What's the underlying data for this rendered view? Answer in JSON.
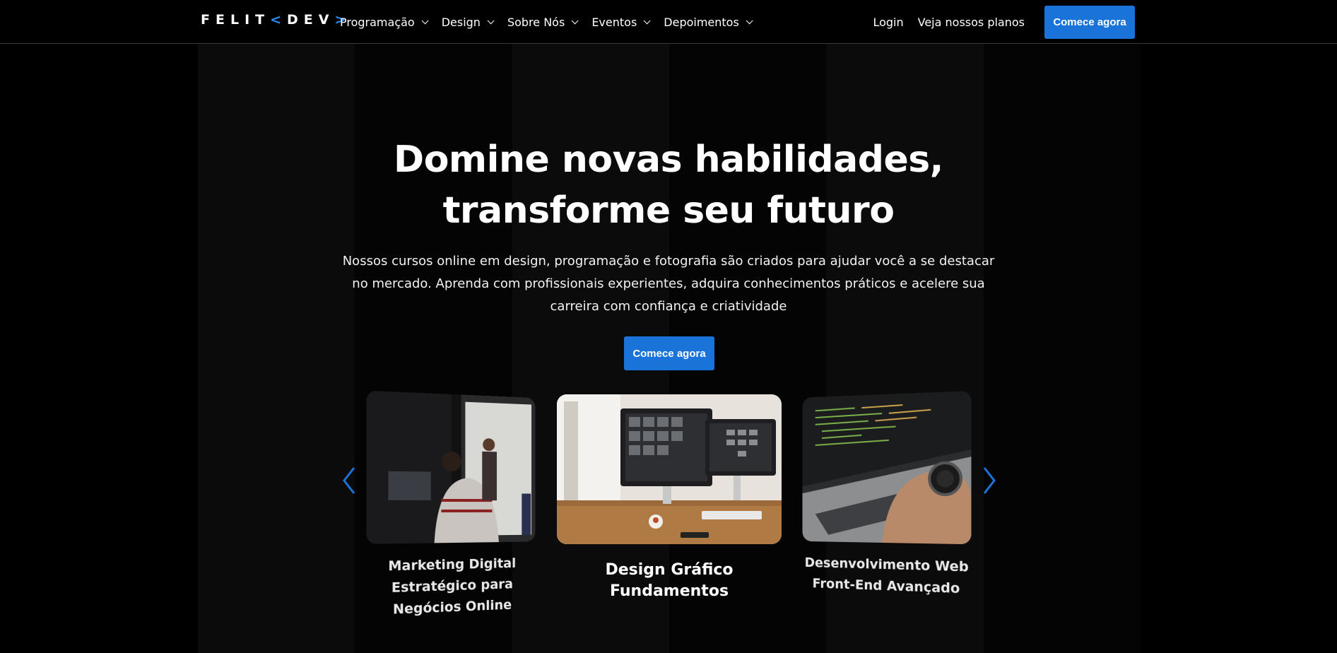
{
  "header": {
    "logo_main": "FELIT",
    "logo_open": "<",
    "logo_sub": "DEV",
    "logo_close": ">",
    "nav": [
      {
        "label": "Programação"
      },
      {
        "label": "Design"
      },
      {
        "label": "Sobre Nós"
      },
      {
        "label": "Eventos"
      },
      {
        "label": "Depoimentos"
      }
    ],
    "login": "Login",
    "plans": "Veja nossos planos",
    "cta": "Comece agora"
  },
  "hero": {
    "title_line1": "Domine novas habilidades,",
    "title_line2": "transforme seu futuro",
    "description": "Nossos cursos online em design, programação e fotografia são criados para ajudar você a se destacar no mercado. Aprenda com profissionais experientes, adquira conhecimentos práticos e acelere sua carreira com confiança e criatividade",
    "cta": "Comece agora"
  },
  "carousel": {
    "cards": [
      {
        "title": "Marketing Digital Estratégico para Negócios Online"
      },
      {
        "title": "Design Gráfico Fundamentos"
      },
      {
        "title": "Desenvolvimento Web Front-End Avançado"
      }
    ]
  },
  "colors": {
    "accent": "#1a73d8",
    "logo_bracket": "#2b8cf0",
    "background": "#000000"
  }
}
